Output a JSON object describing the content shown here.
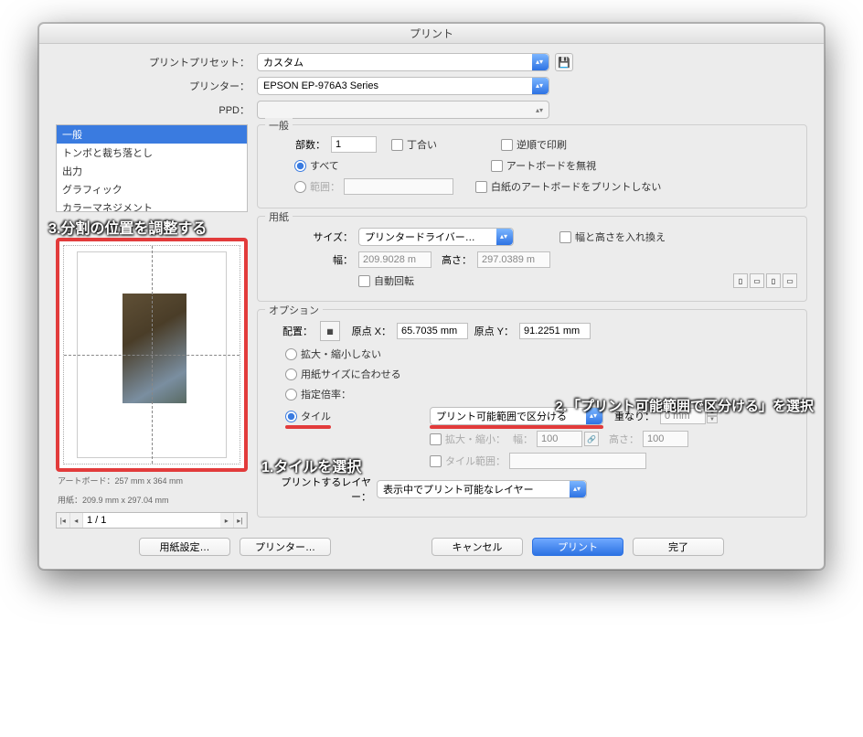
{
  "title": "プリント",
  "presetRow": {
    "label": "プリントプリセット：",
    "value": "カスタム"
  },
  "printerRow": {
    "label": "プリンター：",
    "value": "EPSON EP-976A3 Series"
  },
  "ppdRow": {
    "label": "PPD：",
    "value": ""
  },
  "listbox": {
    "items": [
      "一般",
      "トンボと裁ち落とし",
      "出力",
      "グラフィック",
      "カラーマネジメント"
    ],
    "selected": 0
  },
  "general": {
    "title": "一般",
    "copiesLabel": "部数：",
    "copiesValue": "1",
    "collateLabel": "丁合い",
    "reverseLabel": "逆順で印刷",
    "allLabel": "すべて",
    "ignoreArtboardLabel": "アートボードを無視",
    "rangeLabel": "範囲：",
    "skipBlankLabel": "白紙のアートボードをプリントしない"
  },
  "media": {
    "title": "用紙",
    "sizeLabel": "サイズ：",
    "sizeValue": "プリンタードライバー…",
    "swapLabel": "幅と高さを入れ換え",
    "widthLabel": "幅：",
    "widthValue": "209.9028 m",
    "heightLabel": "高さ：",
    "heightValue": "297.0389 m",
    "autoRotateLabel": "自動回転"
  },
  "options": {
    "title": "オプション",
    "placementLabel": "配置：",
    "originXLabel": "原点 X：",
    "originXValue": "65.7035 mm",
    "originYLabel": "原点 Y：",
    "originYValue": "91.2251 mm",
    "noScaleLabel": "拡大・縮小しない",
    "fitLabel": "用紙サイズに合わせる",
    "customScaleLabel": "指定倍率：",
    "tileLabel": "タイル",
    "tileSelectValue": "プリント可能範囲で区分ける",
    "overlapLabel": "重なり：",
    "overlapValue": "0 mm",
    "scaleLabel": "拡大・縮小：",
    "scaleWLabel": "幅：",
    "scaleWValue": "100",
    "scaleHLabel": "高さ：",
    "scaleHValue": "100",
    "tileRangeLabel": "タイル範囲：",
    "layersLabel": "プリントするレイヤー：",
    "layersValue": "表示中でプリント可能なレイヤー"
  },
  "preview": {
    "artboardLine": "アートボード：257 mm x 364 mm",
    "paperLine": "用紙：209.9 mm x 297.04 mm",
    "pager": "1 / 1"
  },
  "buttons": {
    "mediaSetup": "用紙設定…",
    "printerSetup": "プリンター…",
    "cancel": "キャンセル",
    "print": "プリント",
    "done": "完了"
  },
  "annotations": {
    "a1": "1.タイルを選択",
    "a2": "2.「プリント可能範囲で区分ける」を選択",
    "a3": "3.分割の位置を調整する"
  }
}
